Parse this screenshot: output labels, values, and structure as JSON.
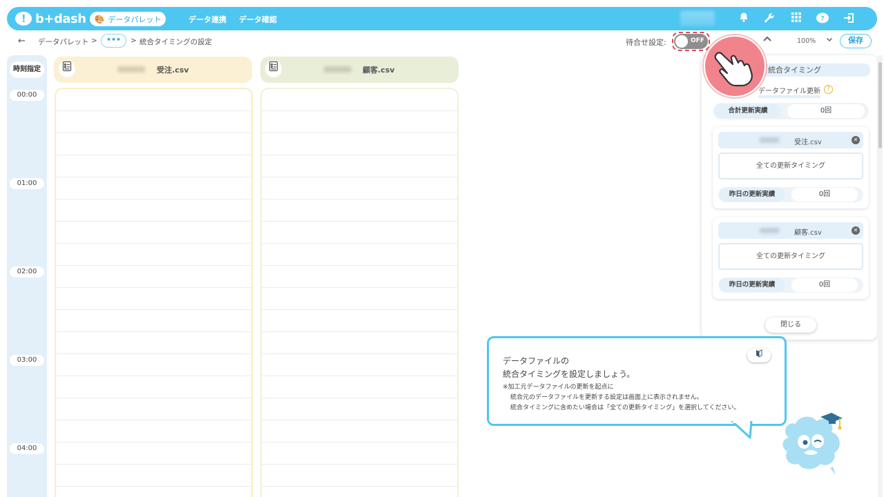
{
  "nav": {
    "brand": "b+dash",
    "active": "データパレット",
    "links": [
      "データ連携",
      "データ確認"
    ]
  },
  "breadcrumb": {
    "back": "←",
    "root": "データパレット",
    "sep1": ">",
    "more": "•••",
    "sep2": ">",
    "current": "統合タイミングの設定"
  },
  "toolbar": {
    "wait_label": "待合せ設定:",
    "toggle": "OFF",
    "zoom": "100%",
    "save": "保存"
  },
  "timeline": {
    "header": "時刻指定",
    "times": [
      "00:00",
      "01:00",
      "02:00",
      "03:00",
      "04:00"
    ]
  },
  "files": [
    {
      "name": "受注.csv",
      "color": "#fbf0d4",
      "border": "#fbedbf"
    },
    {
      "name": "顧客.csv",
      "color": "#e8eed8",
      "border": "#eef2d4"
    }
  ],
  "panel": {
    "title": "統合タイミング",
    "subtitle": "データファイル更新",
    "total_label": "合計更新実績",
    "total_value": "0回",
    "cards": [
      {
        "name": "受注.csv",
        "timing": "全ての更新タイミング",
        "row_label": "昨日の更新実績",
        "row_value": "0回"
      },
      {
        "name": "顧客.csv",
        "timing": "全ての更新タイミング",
        "row_label": "昨日の更新実績",
        "row_value": "0回"
      }
    ],
    "close": "閉じる"
  },
  "tooltip": {
    "line1": "データファイルの",
    "line2": "統合タイミングを設定しましょう。",
    "note1": "※加工元データファイルの更新を起点に",
    "note2": "統合元のデータファイルを更新する設定は画面上に表示されません。",
    "note3": "統合タイミングに含めたい場合は「全ての更新タイミング」を選択してください。"
  }
}
